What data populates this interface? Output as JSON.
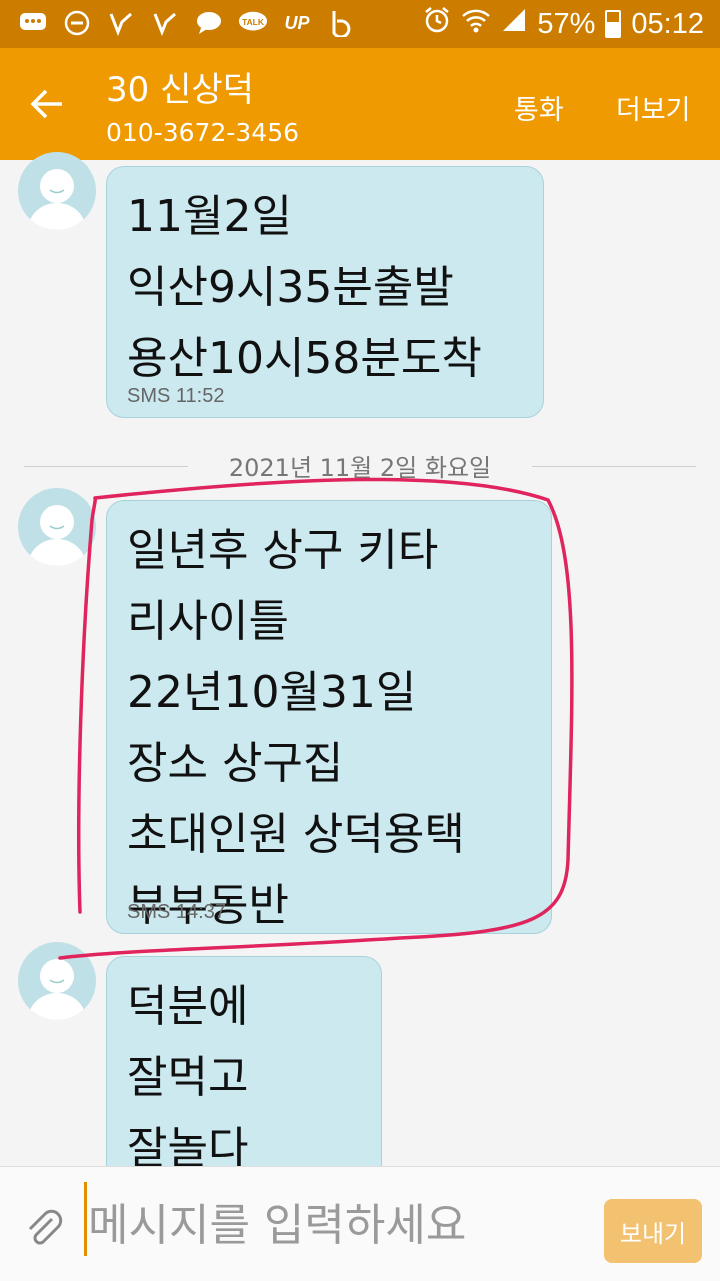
{
  "status_bar": {
    "battery_percent": "57%",
    "battery_level": 0.57,
    "time": "05:12",
    "icons": [
      "message-icon",
      "do-not-disturb-icon",
      "vpn-key-icon",
      "vpn-key-icon",
      "chat-bubble-icon",
      "kakaotalk-icon",
      "up-app-icon",
      "b-app-icon",
      "alarm-icon",
      "wifi-icon",
      "signal-icon",
      "battery-icon"
    ],
    "talk_label": "TALK",
    "up_label": "UP"
  },
  "header": {
    "contact_name": "30 신상덕",
    "phone_number": "010-3672-3456",
    "call_label": "통화",
    "more_label": "더보기"
  },
  "messages": [
    {
      "text": "11월2일\n익산9시35분출발\n용산10시58분도착",
      "meta": "SMS 11:52"
    },
    {
      "text": "일년후 상구 키타\n리사이틀\n22년10월31일\n장소 상구집\n초대인원 상덕용택\n부부동반",
      "meta": "SMS 14:37"
    },
    {
      "text": "덕분에\n잘먹고\n잘놀다",
      "meta": ""
    }
  ],
  "date_divider": "2021년 11월 2일 화요일",
  "input": {
    "placeholder": "메시지를 입력하세요",
    "send_label": "보내기"
  },
  "colors": {
    "header": "#ee9a00",
    "status_bar": "#cc7d00",
    "bubble": "#cbe9ef",
    "highlight_ink": "#e0245e"
  }
}
